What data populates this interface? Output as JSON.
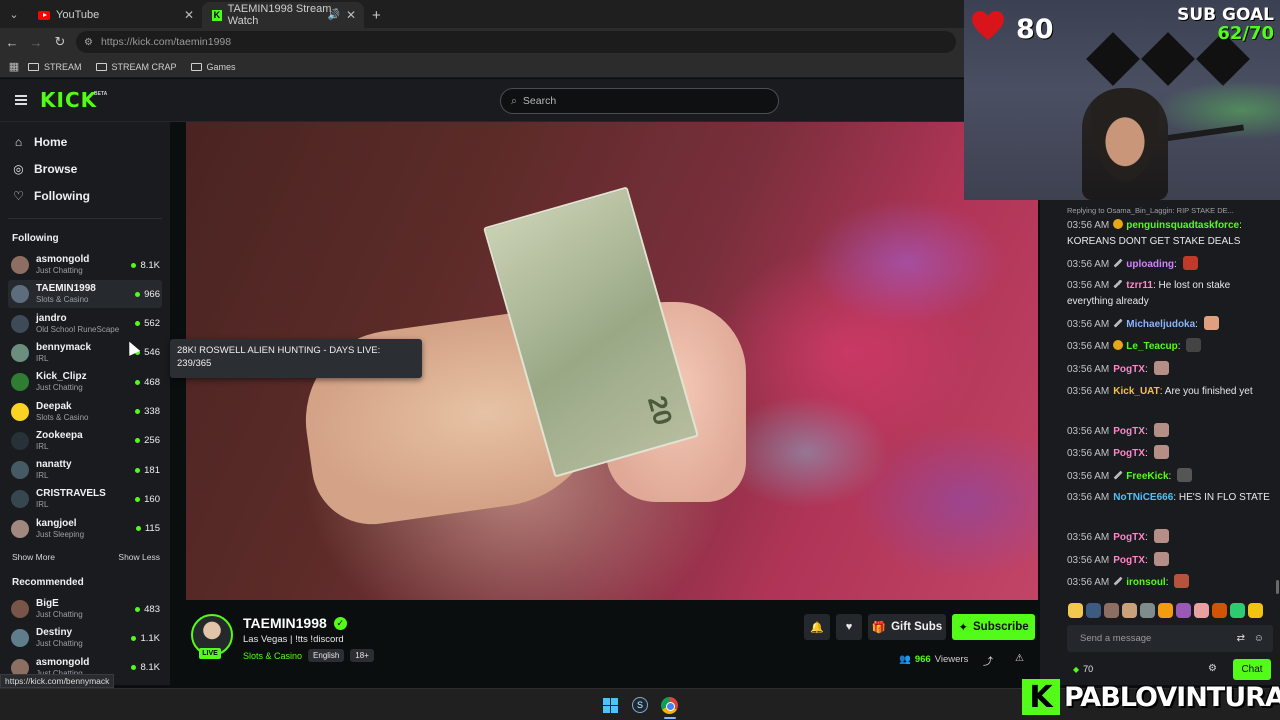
{
  "browser": {
    "tabs": [
      {
        "title": "YouTube",
        "active": false
      },
      {
        "title": "TAEMIN1998 Stream - Watch",
        "active": true
      }
    ],
    "url": "https://kick.com/taemin1998",
    "bookmarks": [
      "STREAM",
      "STREAM CRAP",
      "Games"
    ],
    "status_url": "https://kick.com/bennymack"
  },
  "header": {
    "logo": "KICK",
    "beta": "BETA",
    "search_placeholder": "Search"
  },
  "sidebar": {
    "nav": [
      {
        "label": "Home",
        "icon": "home-icon"
      },
      {
        "label": "Browse",
        "icon": "compass-icon"
      },
      {
        "label": "Following",
        "icon": "heart-icon"
      }
    ],
    "following_title": "Following",
    "following": [
      {
        "name": "asmongold",
        "category": "Just Chatting",
        "viewers": "8.1K",
        "color": "#8d6e63"
      },
      {
        "name": "TAEMIN1998",
        "category": "Slots & Casino",
        "viewers": "966",
        "color": "#5d6d7e"
      },
      {
        "name": "jandro",
        "category": "Old School RuneScape",
        "viewers": "562",
        "color": "#3e4a57"
      },
      {
        "name": "bennymack",
        "category": "IRL",
        "viewers": "546",
        "color": "#6b8e7f"
      },
      {
        "name": "Kick_Clipz",
        "category": "Just Chatting",
        "viewers": "468",
        "color": "#2e7d32"
      },
      {
        "name": "Deepak",
        "category": "Slots & Casino",
        "viewers": "338",
        "color": "#f9d423"
      },
      {
        "name": "Zookeepa",
        "category": "IRL",
        "viewers": "256",
        "color": "#263238"
      },
      {
        "name": "nanatty",
        "category": "IRL",
        "viewers": "181",
        "color": "#455a64"
      },
      {
        "name": "CRISTRAVELS",
        "category": "IRL",
        "viewers": "160",
        "color": "#37474f"
      },
      {
        "name": "kangjoel",
        "category": "Just Sleeping",
        "viewers": "115",
        "color": "#a1887f"
      }
    ],
    "show_more": "Show More",
    "show_less": "Show Less",
    "recommended_title": "Recommended",
    "recommended": [
      {
        "name": "BigE",
        "category": "Just Chatting",
        "viewers": "483",
        "color": "#795548"
      },
      {
        "name": "Destiny",
        "category": "Just Chatting",
        "viewers": "1.1K",
        "color": "#607d8b"
      },
      {
        "name": "asmongold",
        "category": "Just Chatting",
        "viewers": "8.1K",
        "color": "#8d6e63"
      }
    ]
  },
  "tooltip": {
    "line1": "28K! ROSWELL ALIEN HUNTING - DAYS LIVE:",
    "line2": "239/365"
  },
  "stream": {
    "streamer": "TAEMIN1998",
    "live": "LIVE",
    "title": "Las Vegas | !tts !discord",
    "category": "Slots & Casino",
    "tags": [
      "English",
      "18+"
    ],
    "gift_subs": "Gift Subs",
    "subscribe": "Subscribe",
    "viewers": "966",
    "viewers_label": "Viewers"
  },
  "chat": {
    "reply_to": "Replying to Osama_Bin_Laggin: RIP STAKE DE...",
    "messages": [
      {
        "time": "03:56 AM",
        "badge": "gold",
        "user": "penguinsquadtaskforce",
        "color": "#53fc18",
        "text": "KOREANS DONT GET STAKE DEALS",
        "emote": ""
      },
      {
        "time": "03:56 AM",
        "badge": "sword",
        "user": "uploading",
        "color": "#d580ff",
        "text": "",
        "emote": "#c0392b"
      },
      {
        "time": "03:56 AM",
        "badge": "sword",
        "user": "tzrr11",
        "color": "#ff86c8",
        "text": "He lost on stake everything already",
        "emote": ""
      },
      {
        "time": "03:56 AM",
        "badge": "sword",
        "user": "Michaeljudoka",
        "color": "#8ab4f8",
        "text": "",
        "emote": "#e0a080"
      },
      {
        "time": "03:56 AM",
        "badge": "gold",
        "user": "Le_Teacup",
        "color": "#53fc18",
        "text": "",
        "emote": "#444444"
      },
      {
        "time": "03:56 AM",
        "badge": "",
        "user": "PogTX",
        "color": "#ff86c8",
        "text": "",
        "emote": "#b58e86"
      },
      {
        "time": "03:56 AM",
        "badge": "",
        "user": "Kick_UAT",
        "color": "#f5c242",
        "text": "Are you finished yet",
        "emote": ""
      },
      {
        "time": "03:56 AM",
        "badge": "",
        "user": "PogTX",
        "color": "#ff86c8",
        "text": "",
        "emote": "#b58e86"
      },
      {
        "time": "03:56 AM",
        "badge": "",
        "user": "PogTX",
        "color": "#ff86c8",
        "text": "",
        "emote": "#b58e86"
      },
      {
        "time": "03:56 AM",
        "badge": "sword",
        "user": "FreeKick",
        "color": "#53fc18",
        "text": "",
        "emote": "#555555"
      },
      {
        "time": "03:56 AM",
        "badge": "",
        "user": "NoTNiCE666",
        "color": "#4fc3f7",
        "text": "HE'S IN FLO STATE",
        "emote": ""
      },
      {
        "time": "03:56 AM",
        "badge": "",
        "user": "PogTX",
        "color": "#ff86c8",
        "text": "",
        "emote": "#b58e86"
      },
      {
        "time": "03:56 AM",
        "badge": "",
        "user": "PogTX",
        "color": "#ff86c8",
        "text": "",
        "emote": "#b58e86"
      },
      {
        "time": "03:56 AM",
        "badge": "sword",
        "user": "ironsoul",
        "color": "#53fc18",
        "text": "",
        "emote": "#b5533c"
      }
    ],
    "emote_bar": [
      "#f2c94c",
      "#3d5a80",
      "#8d6e63",
      "#c9a27c",
      "#7f8c8d",
      "#f39c12",
      "#9b59b6",
      "#e8a0a0",
      "#d35400",
      "#2ecc71",
      "#f1c40f"
    ],
    "input_placeholder": "Send a message",
    "points": "70",
    "send_label": "Chat"
  },
  "overlay": {
    "likes": "80",
    "sub_goal_label": "SUB GOAL",
    "sub_goal_value": "62/70",
    "brand": "PABLOVINTURA"
  },
  "colors": {
    "kick_green": "#53fc18",
    "bg": "#0b0e0f",
    "panel": "#191b1f"
  }
}
